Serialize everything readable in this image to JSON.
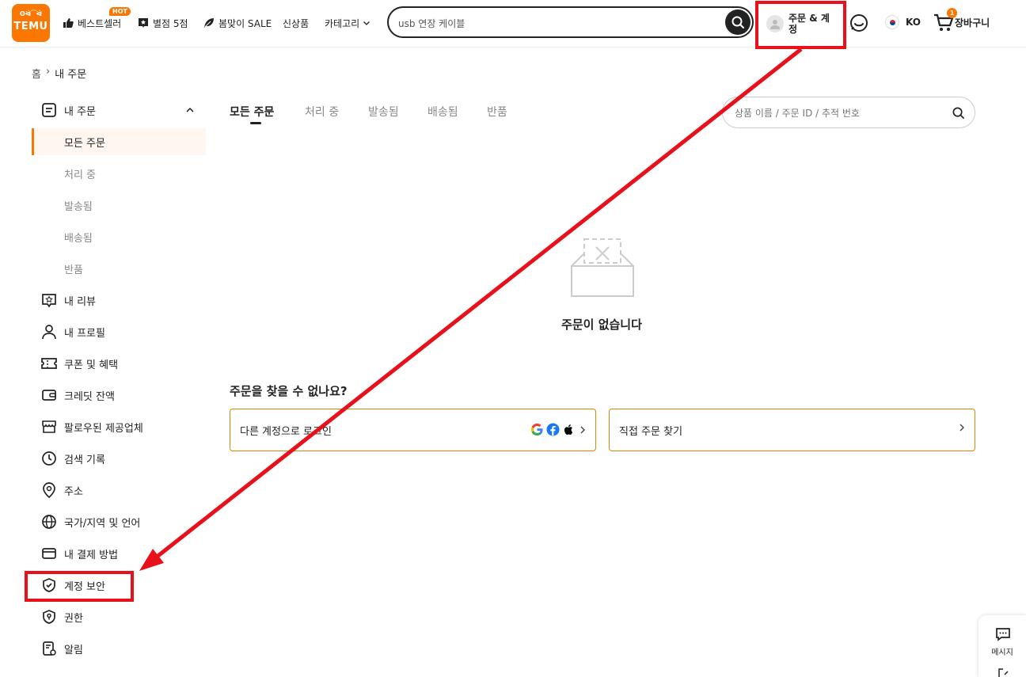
{
  "logo": {
    "top": "ʘᐛ⁀ᐛ",
    "text": "TEMU"
  },
  "nav": {
    "bestseller": "베스트셀러",
    "hot_badge": "HOT",
    "five_star": "별점 5점",
    "spring_sale": "봄맞이 SALE",
    "new_arrivals": "신상품",
    "categories": "카테고리"
  },
  "search": {
    "value": "usb 연장 케이블"
  },
  "account": {
    "label": "주문 & 계정"
  },
  "language": {
    "code": "KO"
  },
  "cart": {
    "label": "장바구니",
    "count": "1"
  },
  "breadcrumb": {
    "home": "홈",
    "separator": "›",
    "current": "내 주문"
  },
  "sidebar": {
    "my_orders": "내 주문",
    "sub": [
      "모든 주문",
      "처리 중",
      "발송됨",
      "배송됨",
      "반품"
    ],
    "items": [
      "내 리뷰",
      "내 프로필",
      "쿠폰 및 혜택",
      "크레딧 잔액",
      "팔로우된 제공업체",
      "검색 기록",
      "주소",
      "국가/지역 및 언어",
      "내 결제 방법",
      "계정 보안",
      "권한",
      "알림"
    ]
  },
  "tabs": [
    "모든 주문",
    "처리 중",
    "발송됨",
    "배송됨",
    "반품"
  ],
  "order_search": {
    "placeholder": "상품 이름 / 주문 ID / 추적 번호"
  },
  "empty": {
    "message": "주문이 없습니다"
  },
  "help": {
    "title": "주문을 찾을 수 없나요?",
    "other_account": "다른 계정으로 로그인",
    "find_order": "직접 주문 찾기"
  },
  "widget": {
    "message": "메시지"
  },
  "colors": {
    "brand": "#fb7701",
    "annotation": "#e8101a"
  },
  "icons": [
    "thumbs-up-icon",
    "star-badge-icon",
    "leaf-icon",
    "chevron-down-icon",
    "search-icon",
    "chat-face-icon",
    "cart-icon",
    "google-icon",
    "facebook-icon",
    "apple-icon"
  ]
}
